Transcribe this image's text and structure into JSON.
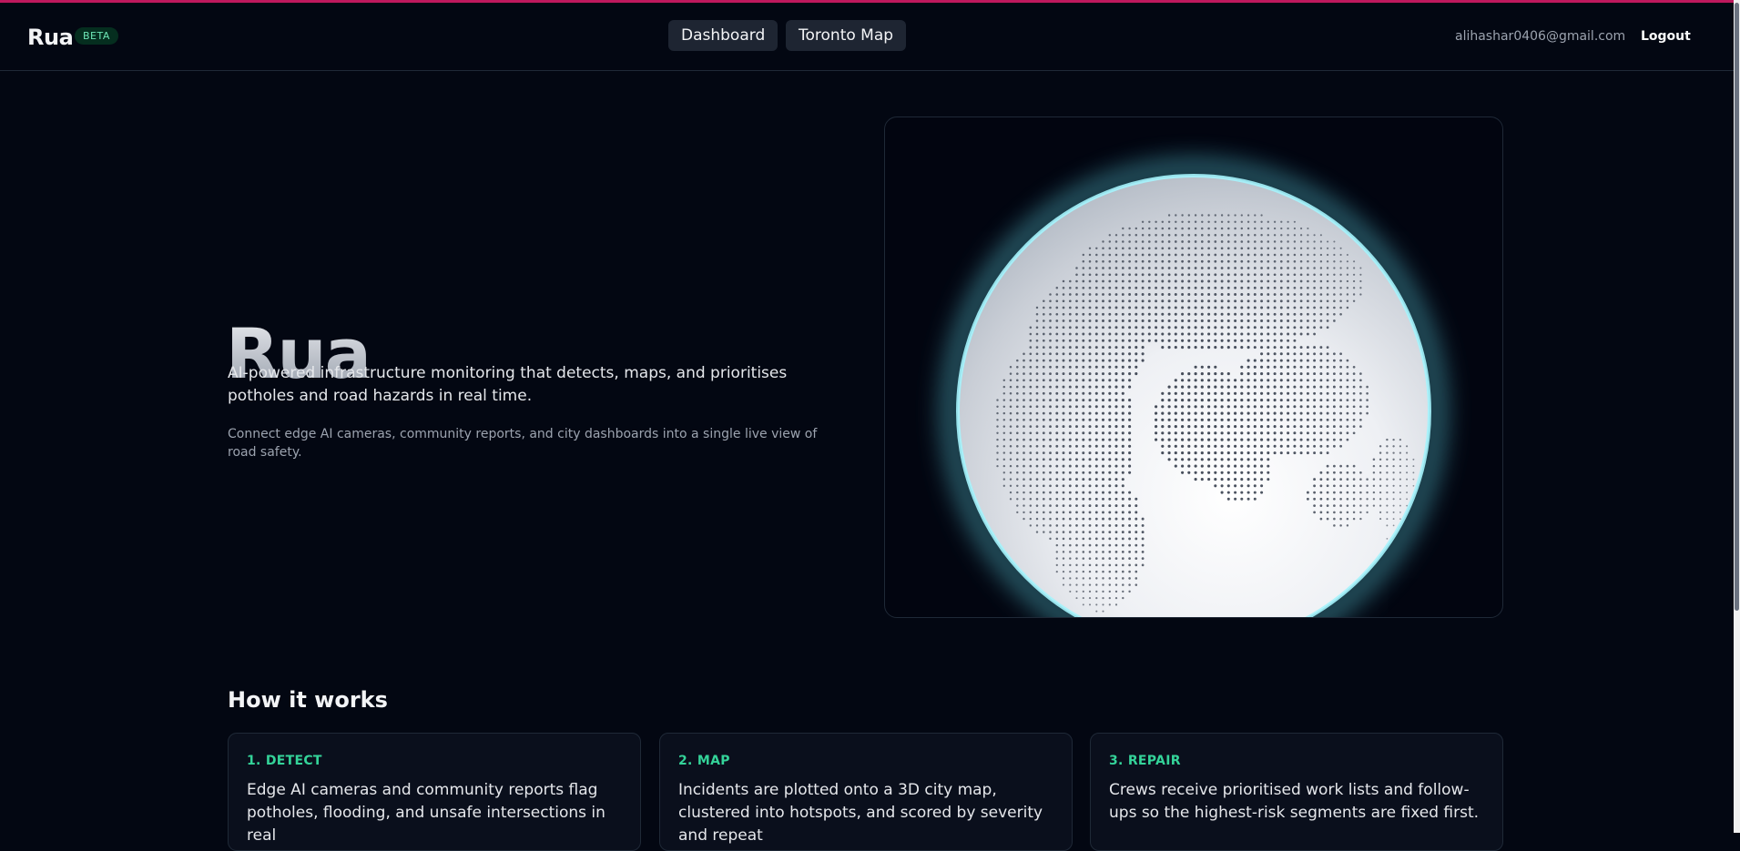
{
  "nav": {
    "brand": "Rua",
    "badge": "BETA",
    "links": [
      {
        "label": "Dashboard"
      },
      {
        "label": "Toronto Map"
      }
    ],
    "user_email": "alihashar0406@gmail.com",
    "logout_label": "Logout"
  },
  "hero": {
    "title": "Rua",
    "subtitle": "AI-powered infrastructure monitoring that detects, maps, and prioritises potholes and road hazards in real time.",
    "note": "Connect edge AI cameras, community reports, and city dashboards into a single live view of road safety."
  },
  "how_it_works": {
    "title": "How it works",
    "steps": [
      {
        "label": "1. DETECT",
        "text": "Edge AI cameras and community reports flag potholes, flooding, and unsafe intersections in real"
      },
      {
        "label": "2. MAP",
        "text": "Incidents are plotted onto a 3D city map, clustered into hotspots, and scored by severity and repeat"
      },
      {
        "label": "3. REPAIR",
        "text": "Crews receive prioritised work lists and follow-ups so the highest-risk segments are fixed first."
      }
    ]
  },
  "colors": {
    "accent_top": "#be185d",
    "step_label": "#34d399",
    "globe_glow": "#67e8f9"
  }
}
